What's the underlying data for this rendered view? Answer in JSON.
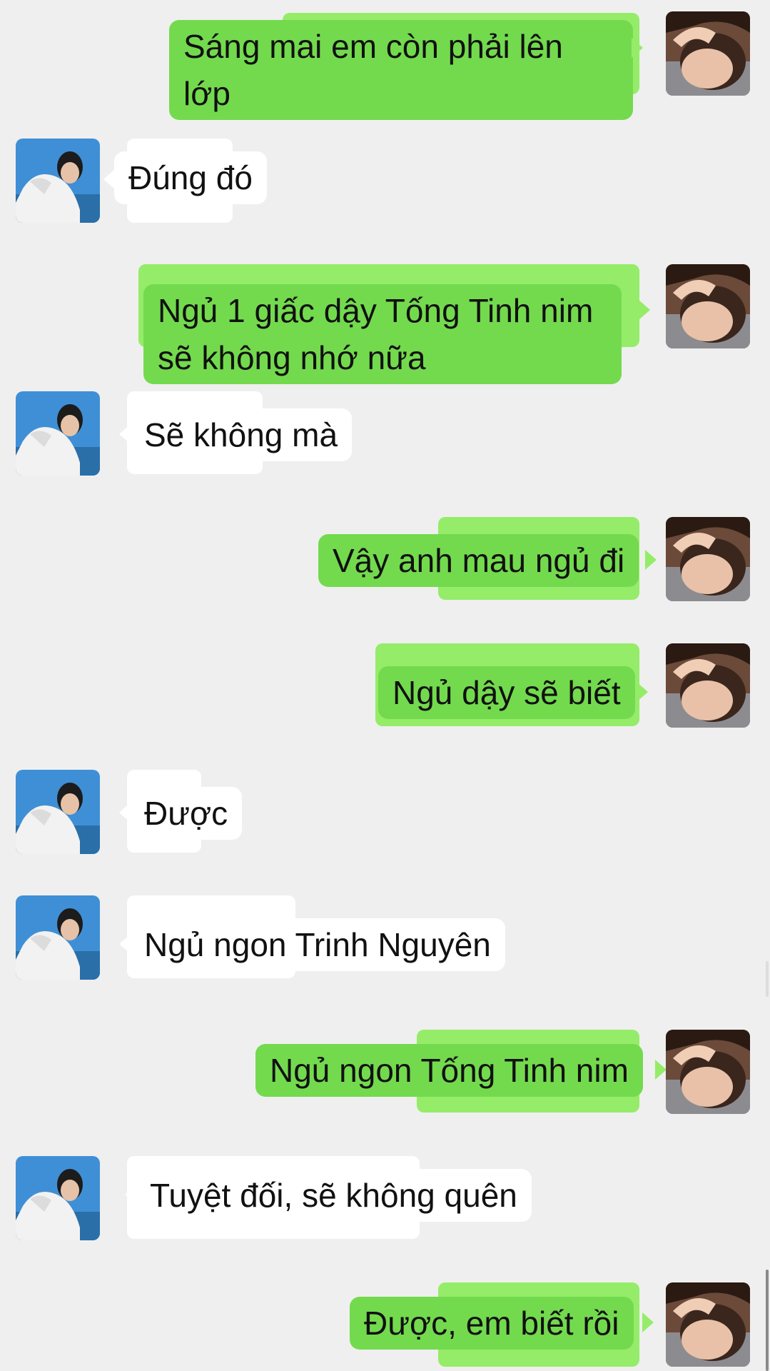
{
  "messages": [
    {
      "side": "right",
      "text": "Sáng mai em còn phải lên lớp"
    },
    {
      "side": "left",
      "text": "Đúng đó"
    },
    {
      "side": "right",
      "text": "Ngủ 1 giấc dậy Tống Tinh nim\nsẽ không nhớ nữa"
    },
    {
      "side": "left",
      "text": "Sẽ không mà"
    },
    {
      "side": "right",
      "text": "Vậy anh mau ngủ đi"
    },
    {
      "side": "right",
      "text": "Ngủ dậy sẽ biết"
    },
    {
      "side": "left",
      "text": "Được"
    },
    {
      "side": "left",
      "text": "Ngủ ngon Trinh Nguyên"
    },
    {
      "side": "right",
      "text": "Ngủ ngon Tống Tinh nim"
    },
    {
      "side": "left",
      "text": "Tuyệt đối, sẽ không quên"
    },
    {
      "side": "right",
      "text": "Được, em biết rồi"
    }
  ],
  "avatars": {
    "self": "avatar-self-photo",
    "other": "avatar-other-photo"
  },
  "colors": {
    "background": "#efefef",
    "self_bubble": "#73da4e",
    "self_bubble_back": "#95ec69",
    "other_bubble": "#ffffff"
  }
}
